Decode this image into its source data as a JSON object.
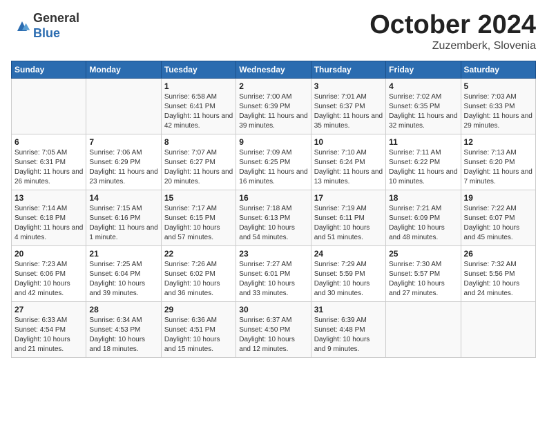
{
  "header": {
    "logo_general": "General",
    "logo_blue": "Blue",
    "month": "October 2024",
    "location": "Zuzemberk, Slovenia"
  },
  "days_of_week": [
    "Sunday",
    "Monday",
    "Tuesday",
    "Wednesday",
    "Thursday",
    "Friday",
    "Saturday"
  ],
  "weeks": [
    [
      {
        "day": "",
        "info": ""
      },
      {
        "day": "",
        "info": ""
      },
      {
        "day": "1",
        "info": "Sunrise: 6:58 AM\nSunset: 6:41 PM\nDaylight: 11 hours and 42 minutes."
      },
      {
        "day": "2",
        "info": "Sunrise: 7:00 AM\nSunset: 6:39 PM\nDaylight: 11 hours and 39 minutes."
      },
      {
        "day": "3",
        "info": "Sunrise: 7:01 AM\nSunset: 6:37 PM\nDaylight: 11 hours and 35 minutes."
      },
      {
        "day": "4",
        "info": "Sunrise: 7:02 AM\nSunset: 6:35 PM\nDaylight: 11 hours and 32 minutes."
      },
      {
        "day": "5",
        "info": "Sunrise: 7:03 AM\nSunset: 6:33 PM\nDaylight: 11 hours and 29 minutes."
      }
    ],
    [
      {
        "day": "6",
        "info": "Sunrise: 7:05 AM\nSunset: 6:31 PM\nDaylight: 11 hours and 26 minutes."
      },
      {
        "day": "7",
        "info": "Sunrise: 7:06 AM\nSunset: 6:29 PM\nDaylight: 11 hours and 23 minutes."
      },
      {
        "day": "8",
        "info": "Sunrise: 7:07 AM\nSunset: 6:27 PM\nDaylight: 11 hours and 20 minutes."
      },
      {
        "day": "9",
        "info": "Sunrise: 7:09 AM\nSunset: 6:25 PM\nDaylight: 11 hours and 16 minutes."
      },
      {
        "day": "10",
        "info": "Sunrise: 7:10 AM\nSunset: 6:24 PM\nDaylight: 11 hours and 13 minutes."
      },
      {
        "day": "11",
        "info": "Sunrise: 7:11 AM\nSunset: 6:22 PM\nDaylight: 11 hours and 10 minutes."
      },
      {
        "day": "12",
        "info": "Sunrise: 7:13 AM\nSunset: 6:20 PM\nDaylight: 11 hours and 7 minutes."
      }
    ],
    [
      {
        "day": "13",
        "info": "Sunrise: 7:14 AM\nSunset: 6:18 PM\nDaylight: 11 hours and 4 minutes."
      },
      {
        "day": "14",
        "info": "Sunrise: 7:15 AM\nSunset: 6:16 PM\nDaylight: 11 hours and 1 minute."
      },
      {
        "day": "15",
        "info": "Sunrise: 7:17 AM\nSunset: 6:15 PM\nDaylight: 10 hours and 57 minutes."
      },
      {
        "day": "16",
        "info": "Sunrise: 7:18 AM\nSunset: 6:13 PM\nDaylight: 10 hours and 54 minutes."
      },
      {
        "day": "17",
        "info": "Sunrise: 7:19 AM\nSunset: 6:11 PM\nDaylight: 10 hours and 51 minutes."
      },
      {
        "day": "18",
        "info": "Sunrise: 7:21 AM\nSunset: 6:09 PM\nDaylight: 10 hours and 48 minutes."
      },
      {
        "day": "19",
        "info": "Sunrise: 7:22 AM\nSunset: 6:07 PM\nDaylight: 10 hours and 45 minutes."
      }
    ],
    [
      {
        "day": "20",
        "info": "Sunrise: 7:23 AM\nSunset: 6:06 PM\nDaylight: 10 hours and 42 minutes."
      },
      {
        "day": "21",
        "info": "Sunrise: 7:25 AM\nSunset: 6:04 PM\nDaylight: 10 hours and 39 minutes."
      },
      {
        "day": "22",
        "info": "Sunrise: 7:26 AM\nSunset: 6:02 PM\nDaylight: 10 hours and 36 minutes."
      },
      {
        "day": "23",
        "info": "Sunrise: 7:27 AM\nSunset: 6:01 PM\nDaylight: 10 hours and 33 minutes."
      },
      {
        "day": "24",
        "info": "Sunrise: 7:29 AM\nSunset: 5:59 PM\nDaylight: 10 hours and 30 minutes."
      },
      {
        "day": "25",
        "info": "Sunrise: 7:30 AM\nSunset: 5:57 PM\nDaylight: 10 hours and 27 minutes."
      },
      {
        "day": "26",
        "info": "Sunrise: 7:32 AM\nSunset: 5:56 PM\nDaylight: 10 hours and 24 minutes."
      }
    ],
    [
      {
        "day": "27",
        "info": "Sunrise: 6:33 AM\nSunset: 4:54 PM\nDaylight: 10 hours and 21 minutes."
      },
      {
        "day": "28",
        "info": "Sunrise: 6:34 AM\nSunset: 4:53 PM\nDaylight: 10 hours and 18 minutes."
      },
      {
        "day": "29",
        "info": "Sunrise: 6:36 AM\nSunset: 4:51 PM\nDaylight: 10 hours and 15 minutes."
      },
      {
        "day": "30",
        "info": "Sunrise: 6:37 AM\nSunset: 4:50 PM\nDaylight: 10 hours and 12 minutes."
      },
      {
        "day": "31",
        "info": "Sunrise: 6:39 AM\nSunset: 4:48 PM\nDaylight: 10 hours and 9 minutes."
      },
      {
        "day": "",
        "info": ""
      },
      {
        "day": "",
        "info": ""
      }
    ]
  ]
}
